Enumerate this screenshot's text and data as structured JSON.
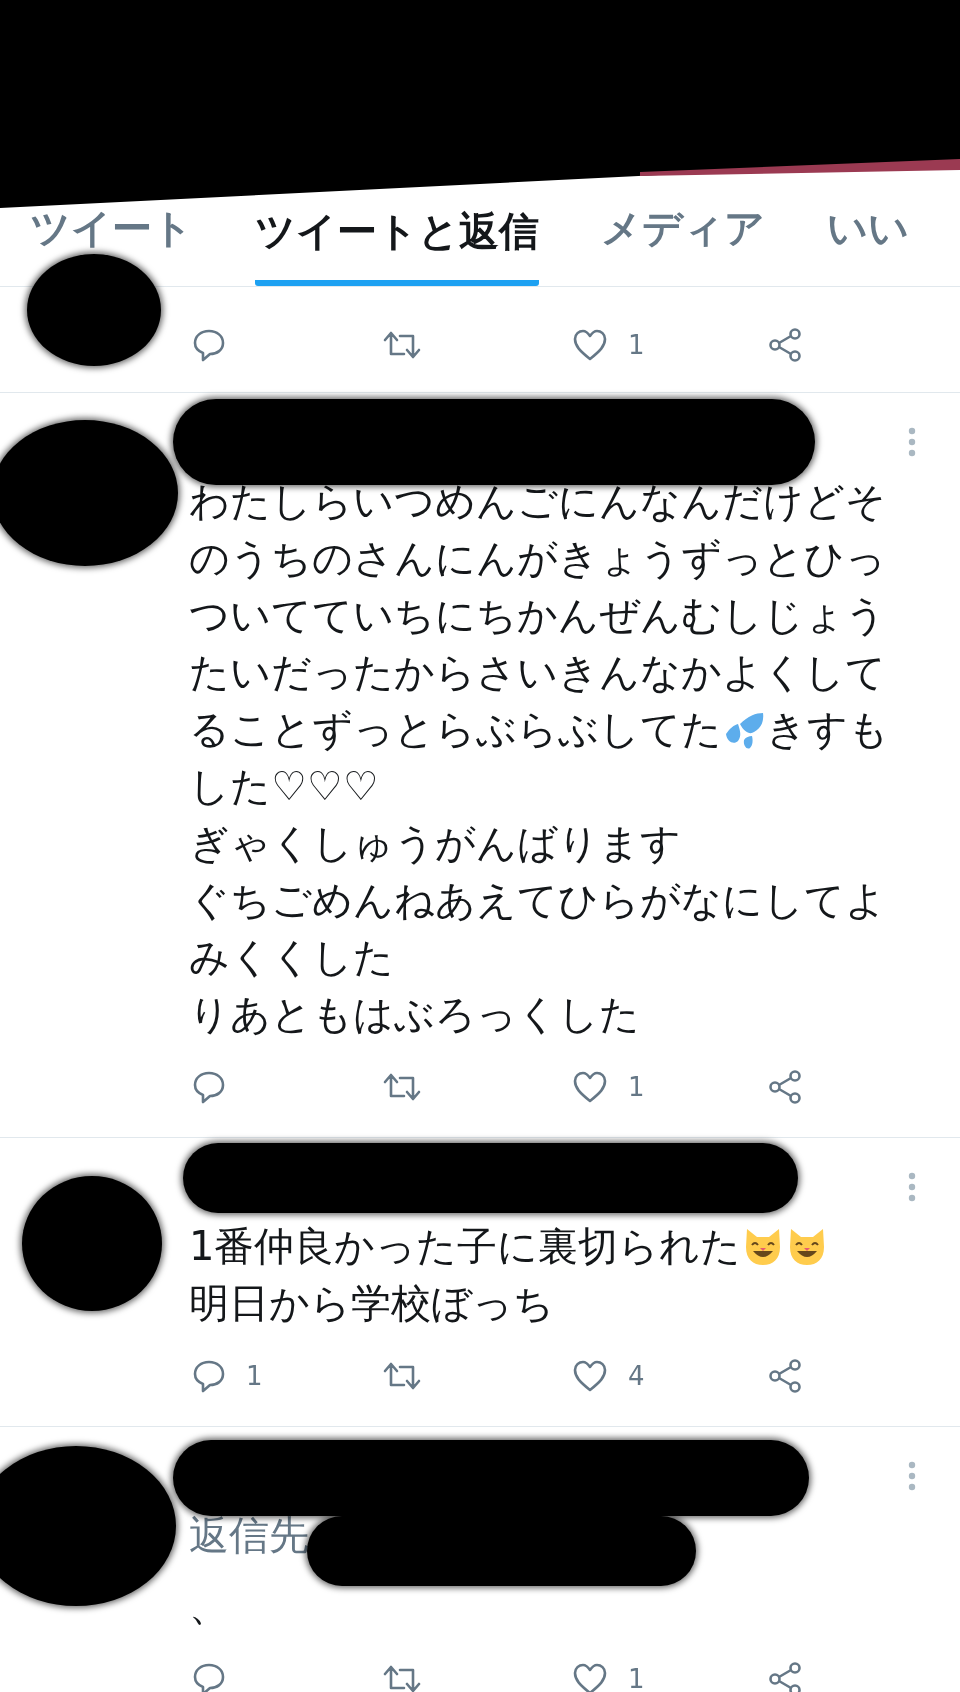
{
  "tabs": [
    {
      "label": "ツイート",
      "selected": false
    },
    {
      "label": "ツイートと返信",
      "selected": true
    },
    {
      "label": "メディア",
      "selected": false
    },
    {
      "label": "いい",
      "selected": false
    }
  ],
  "tweets": [
    {
      "actions": {
        "like_count": "1"
      }
    },
    {
      "lines": [
        [
          {
            "kind": "text",
            "text": "わたしらいつめんごにんなんだけどそ"
          }
        ],
        [
          {
            "kind": "text",
            "text": "のうちのさんにんがきょうずっとひっ"
          }
        ],
        [
          {
            "kind": "text",
            "text": "ついてていちにちかんぜんむしじょう"
          }
        ],
        [
          {
            "kind": "text",
            "text": "たいだったからさいきんなかよくして"
          }
        ],
        [
          {
            "kind": "text",
            "text": "ることずっとらぶらぶしてた"
          },
          {
            "kind": "drops"
          },
          {
            "kind": "text",
            "text": "きすも"
          }
        ],
        [
          {
            "kind": "text",
            "text": "した♡♡♡"
          }
        ],
        [
          {
            "kind": "text",
            "text": "ぎゃくしゅうがんばります"
          }
        ],
        [
          {
            "kind": "text",
            "text": "ぐちごめんねあえてひらがなにしてよ"
          }
        ],
        [
          {
            "kind": "text",
            "text": "みくくした"
          }
        ],
        [
          {
            "kind": "text",
            "text": "りあともはぶろっくした"
          }
        ]
      ],
      "actions": {
        "like_count": "1"
      }
    },
    {
      "lines": [
        [
          {
            "kind": "text",
            "text": "1番仲良かった子に裏切られた"
          },
          {
            "kind": "cat"
          },
          {
            "kind": "cat"
          }
        ],
        [
          {
            "kind": "text",
            "text": "明日から学校ぼっち"
          }
        ]
      ],
      "actions": {
        "reply_count": "1",
        "like_count": "4"
      }
    },
    {
      "reply_to": "返信先",
      "lines": [
        [
          {
            "kind": "text",
            "text": "、"
          }
        ]
      ],
      "actions": {
        "like_count": "1"
      }
    }
  ]
}
